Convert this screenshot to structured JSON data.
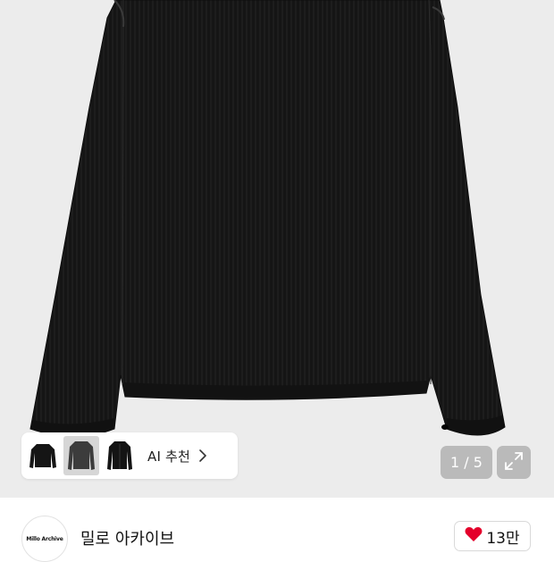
{
  "gallery": {
    "image_alt": "black ribbed knit long-sleeve sweater",
    "counter_text": "1 / 5",
    "expand_icon": "expand-icon"
  },
  "ai_recommend": {
    "label": "AI 추천",
    "thumbnails": [
      "black-sweater",
      "gray-sweater-selected",
      "black-cardigan"
    ],
    "chevron_icon": "chevron-right-icon"
  },
  "shop": {
    "avatar_text": "Millo Archive",
    "name": "밀로 아카이브",
    "like_icon": "heart-icon",
    "like_color": "#e4002b",
    "like_count": "13만"
  }
}
